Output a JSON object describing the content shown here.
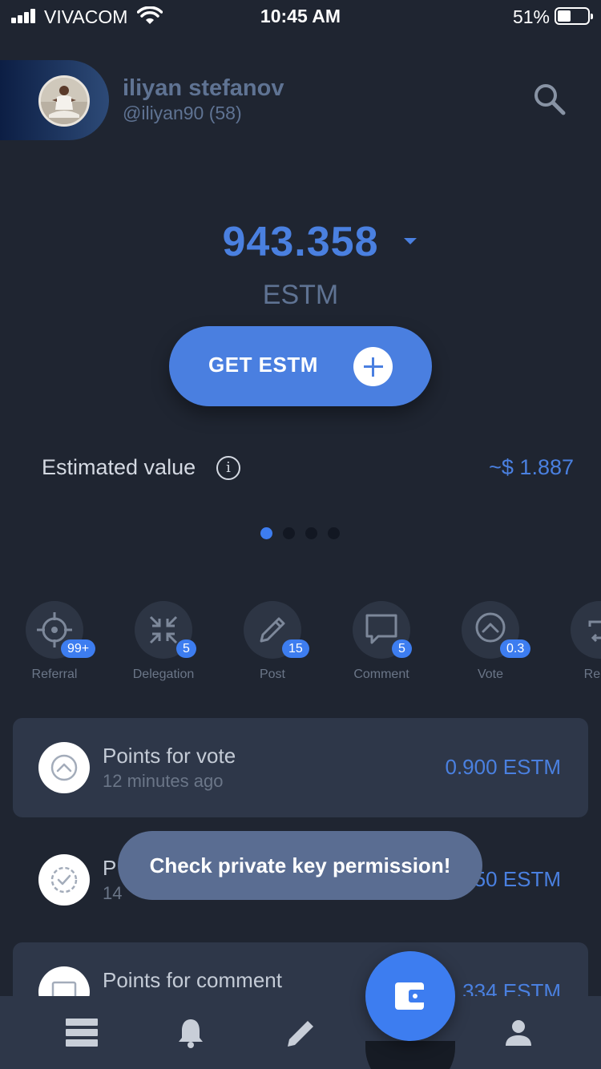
{
  "status_bar": {
    "carrier": "VIVACOM",
    "time": "10:45 AM",
    "battery_percent": "51%",
    "battery_level": 0.51,
    "icons": [
      "signal-icon",
      "wifi-icon",
      "battery-icon"
    ]
  },
  "profile": {
    "name": "iliyan stefanov",
    "handle": "@iliyan90 (58)",
    "icons": [
      "avatar",
      "search-icon"
    ]
  },
  "balance": {
    "value": "943.358",
    "unit": "ESTM",
    "caret_icon": "caret-down-icon"
  },
  "get_button": {
    "label": "GET ESTM",
    "icon": "plus-icon"
  },
  "estimated": {
    "label": "Estimated value",
    "value": "~$ 1.887",
    "icon": "info-icon"
  },
  "pager": {
    "count": 4,
    "active": 0
  },
  "activities": [
    {
      "label": "Referral",
      "badge": "99+",
      "icon": "crosshair-icon"
    },
    {
      "label": "Delegation",
      "badge": "5",
      "icon": "delegation-icon"
    },
    {
      "label": "Post",
      "badge": "15",
      "icon": "pencil-icon"
    },
    {
      "label": "Comment",
      "badge": "5",
      "icon": "comment-icon"
    },
    {
      "label": "Vote",
      "badge": "0.3",
      "icon": "upvote-icon"
    },
    {
      "label": "Reb",
      "badge": "",
      "icon": "reblog-icon"
    }
  ],
  "transactions": [
    {
      "title": "Points for vote",
      "time": "12 minutes ago",
      "amount": "0.900 ESTM",
      "icon": "upvote-icon"
    },
    {
      "title": "P",
      "time": "14",
      "amount": "50 ESTM",
      "icon": "check-circle-icon"
    },
    {
      "title": "Points for comment",
      "time": "",
      "amount": ".334 ESTM",
      "icon": "comment-icon"
    }
  ],
  "toast": {
    "message": "Check private key permission!"
  },
  "bottom_nav": {
    "items": [
      {
        "name": "feed",
        "icon": "feed-icon"
      },
      {
        "name": "notifications",
        "icon": "bell-icon"
      },
      {
        "name": "editor",
        "icon": "pencil-icon"
      },
      {
        "name": "wallet",
        "icon": "wallet-icon"
      },
      {
        "name": "profile",
        "icon": "person-icon"
      }
    ]
  },
  "colors": {
    "background": "#1f2531",
    "accent": "#4a80e0",
    "card": "#2e3749",
    "muted": "#5f7393",
    "toast": "#5a6d92"
  }
}
